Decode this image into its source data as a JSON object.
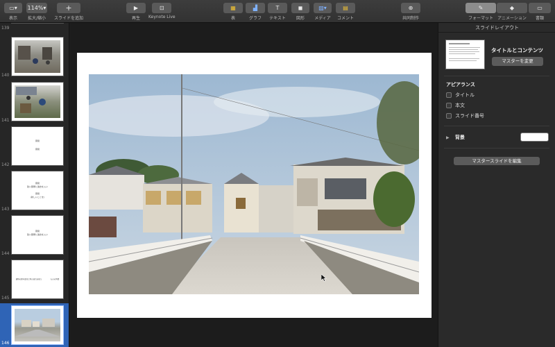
{
  "toolbar": {
    "view_label": "表示",
    "zoom_value": "114%",
    "zoom_label": "拡大/縮小",
    "add_slide_label": "スライドを追加",
    "play_label": "再生",
    "keynote_live_label": "Keynote Live",
    "table_label": "表",
    "chart_label": "グラフ",
    "text_label": "テキスト",
    "shape_label": "図形",
    "media_label": "メディア",
    "comment_label": "コメント",
    "collaborate_label": "共同制作",
    "format_label": "フォーマット",
    "animate_label": "アニメーション",
    "document_label": "書類"
  },
  "slides": [
    {
      "num": "139"
    },
    {
      "num": "140"
    },
    {
      "num": "141"
    },
    {
      "num": "142",
      "lines": [
        "幕間",
        "",
        "幕間"
      ]
    },
    {
      "num": "143",
      "lines": [
        "幕間",
        "建い部屋に過去を入い",
        "",
        "幕間",
        "(新しいことを)"
      ]
    },
    {
      "num": "144",
      "lines": [
        "幕間",
        "建い部屋に過去を入い"
      ]
    },
    {
      "num": "145",
      "lines": [
        "建物の経年変化と時の流れを想う　　　　　ものの時間"
      ]
    },
    {
      "num": "146"
    }
  ],
  "inspector": {
    "title": "スライドレイアウト",
    "layout_name": "タイトルとコンテンツ",
    "change_master_label": "マスターを変更",
    "appearance_label": "アピアランス",
    "title_check_label": "タイトル",
    "body_check_label": "本文",
    "slide_number_check_label": "スライド番号",
    "background_label": "背景",
    "edit_master_label": "マスタースライドを編集"
  },
  "colors": {
    "selection": "#2f64b6",
    "toolbar_bg": "#343434",
    "sky": "#aac2d8"
  }
}
